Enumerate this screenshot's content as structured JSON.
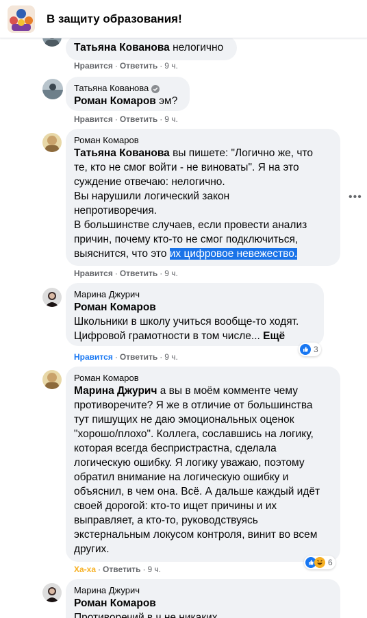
{
  "header": {
    "title": "В защиту образования!"
  },
  "comments": [
    {
      "author": "",
      "mention": "Татьяна Кованова",
      "text": " нелогично",
      "like": "Нравится",
      "reply": "Ответить",
      "time": "9 ч."
    },
    {
      "author": "Татьяна Кованова",
      "mention": "Роман Комаров",
      "text": " эм?",
      "like": "Нравится",
      "reply": "Ответить",
      "time": "9 ч."
    },
    {
      "author": "Роман Комаров",
      "mention": "Татьяна Кованова",
      "lines": [
        " вы пишете: \"Логично же, что",
        "те, кто не смог войти - не виноваты\". Я на это",
        "суждение отвечаю: нелогично.",
        "Вы нарушили логический закон",
        "непротиворечия.",
        "В большинстве случаев, если провести анализ",
        "причин, почему кто-то не смог подключиться,",
        "выяснится, что это "
      ],
      "highlight": "их цифровое невежество.",
      "like": "Нравится",
      "reply": "Ответить",
      "time": "9 ч."
    },
    {
      "author": "Марина Джурич",
      "mention": "Роман Комаров",
      "lines": [
        "Школьники в школу учиться вообще-то ходят.",
        "Цифровой грамотности в том числе... "
      ],
      "more": "Ещё",
      "like": "Нравится",
      "reply": "Ответить",
      "time": "9 ч.",
      "reaction_count": "3"
    },
    {
      "author": "Роман Комаров",
      "mention": "Марина Джурич",
      "lines": [
        " а вы в моём комменте чему",
        "противоречите? Я же в отличие от большинства",
        "тут пишущих не даю эмоциональных оценок",
        "\"хорошо/плохо\". Коллега, сославшись на логику,",
        "которая всегда беспристрастна, сделала",
        "логическую ошибку. Я логику уважаю, поэтому",
        "обратил внимание на логическую ошибку и",
        "объяснил, в чем она. Всё. А дальше каждый идёт",
        "своей дорогой: кто-то ищет причины и их",
        "выправляет, а кто-то, руководствуясь",
        "экстернальным локусом контроля, винит во всем",
        "других."
      ],
      "like": "Ха-ха",
      "reply": "Ответить",
      "time": "9 ч.",
      "reaction_count": "6"
    },
    {
      "author": "Марина Джурич",
      "mention": "Роман Комаров",
      "lines": [
        "Противоречий в ч не никаких"
      ]
    }
  ],
  "more_options": "•••",
  "colors": {
    "bubble": "#f0f2f5",
    "meta": "#65676b",
    "like_active": "#1877f2",
    "haha": "#f7b125",
    "highlight": "#1a73e8"
  }
}
